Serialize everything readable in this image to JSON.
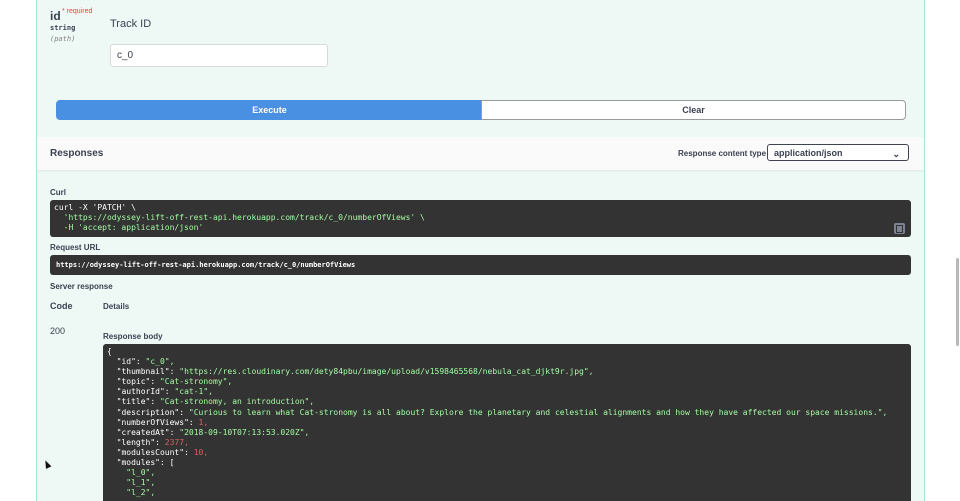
{
  "parameter": {
    "name": "id",
    "required_marker": "* required",
    "type": "string",
    "location": "(path)",
    "description": "Track ID",
    "value": "c_0"
  },
  "buttons": {
    "execute": "Execute",
    "clear": "Clear"
  },
  "responses": {
    "title": "Responses",
    "content_type_label": "Response content type",
    "content_type_value": "application/json"
  },
  "curl": {
    "label": "Curl",
    "line1": "curl -X 'PATCH' \\",
    "line2": "  'https://odyssey-lift-off-rest-api.herokuapp.com/track/c_0/numberOfViews' \\",
    "line3": "  -H 'accept: application/json'"
  },
  "request_url": {
    "label": "Request URL",
    "value": "https://odyssey-lift-off-rest-api.herokuapp.com/track/c_0/numberOfViews"
  },
  "server_response": {
    "label": "Server response",
    "code_header": "Code",
    "details_header": "Details",
    "code": "200",
    "body_label": "Response body"
  },
  "response_body": [
    "{",
    "  \"id\": \"c_0\",",
    "  \"thumbnail\": \"https://res.cloudinary.com/dety84pbu/image/upload/v1598465568/nebula_cat_djkt9r.jpg\",",
    "  \"topic\": \"Cat-stronomy\",",
    "  \"authorId\": \"cat-1\",",
    "  \"title\": \"Cat-stronomy, an introduction\",",
    "  \"description\": \"Curious to learn what Cat-stronomy is all about? Explore the planetary and celestial alignments and how they have affected our space missions.\",",
    "  \"numberOfViews\": 1,",
    "  \"createdAt\": \"2018-09-10T07:13:53.020Z\",",
    "  \"length\": 2377,",
    "  \"modulesCount\": 10,",
    "  \"modules\": [",
    "    \"l_0\",",
    "    \"l_1\",",
    "    \"l_2\","
  ]
}
